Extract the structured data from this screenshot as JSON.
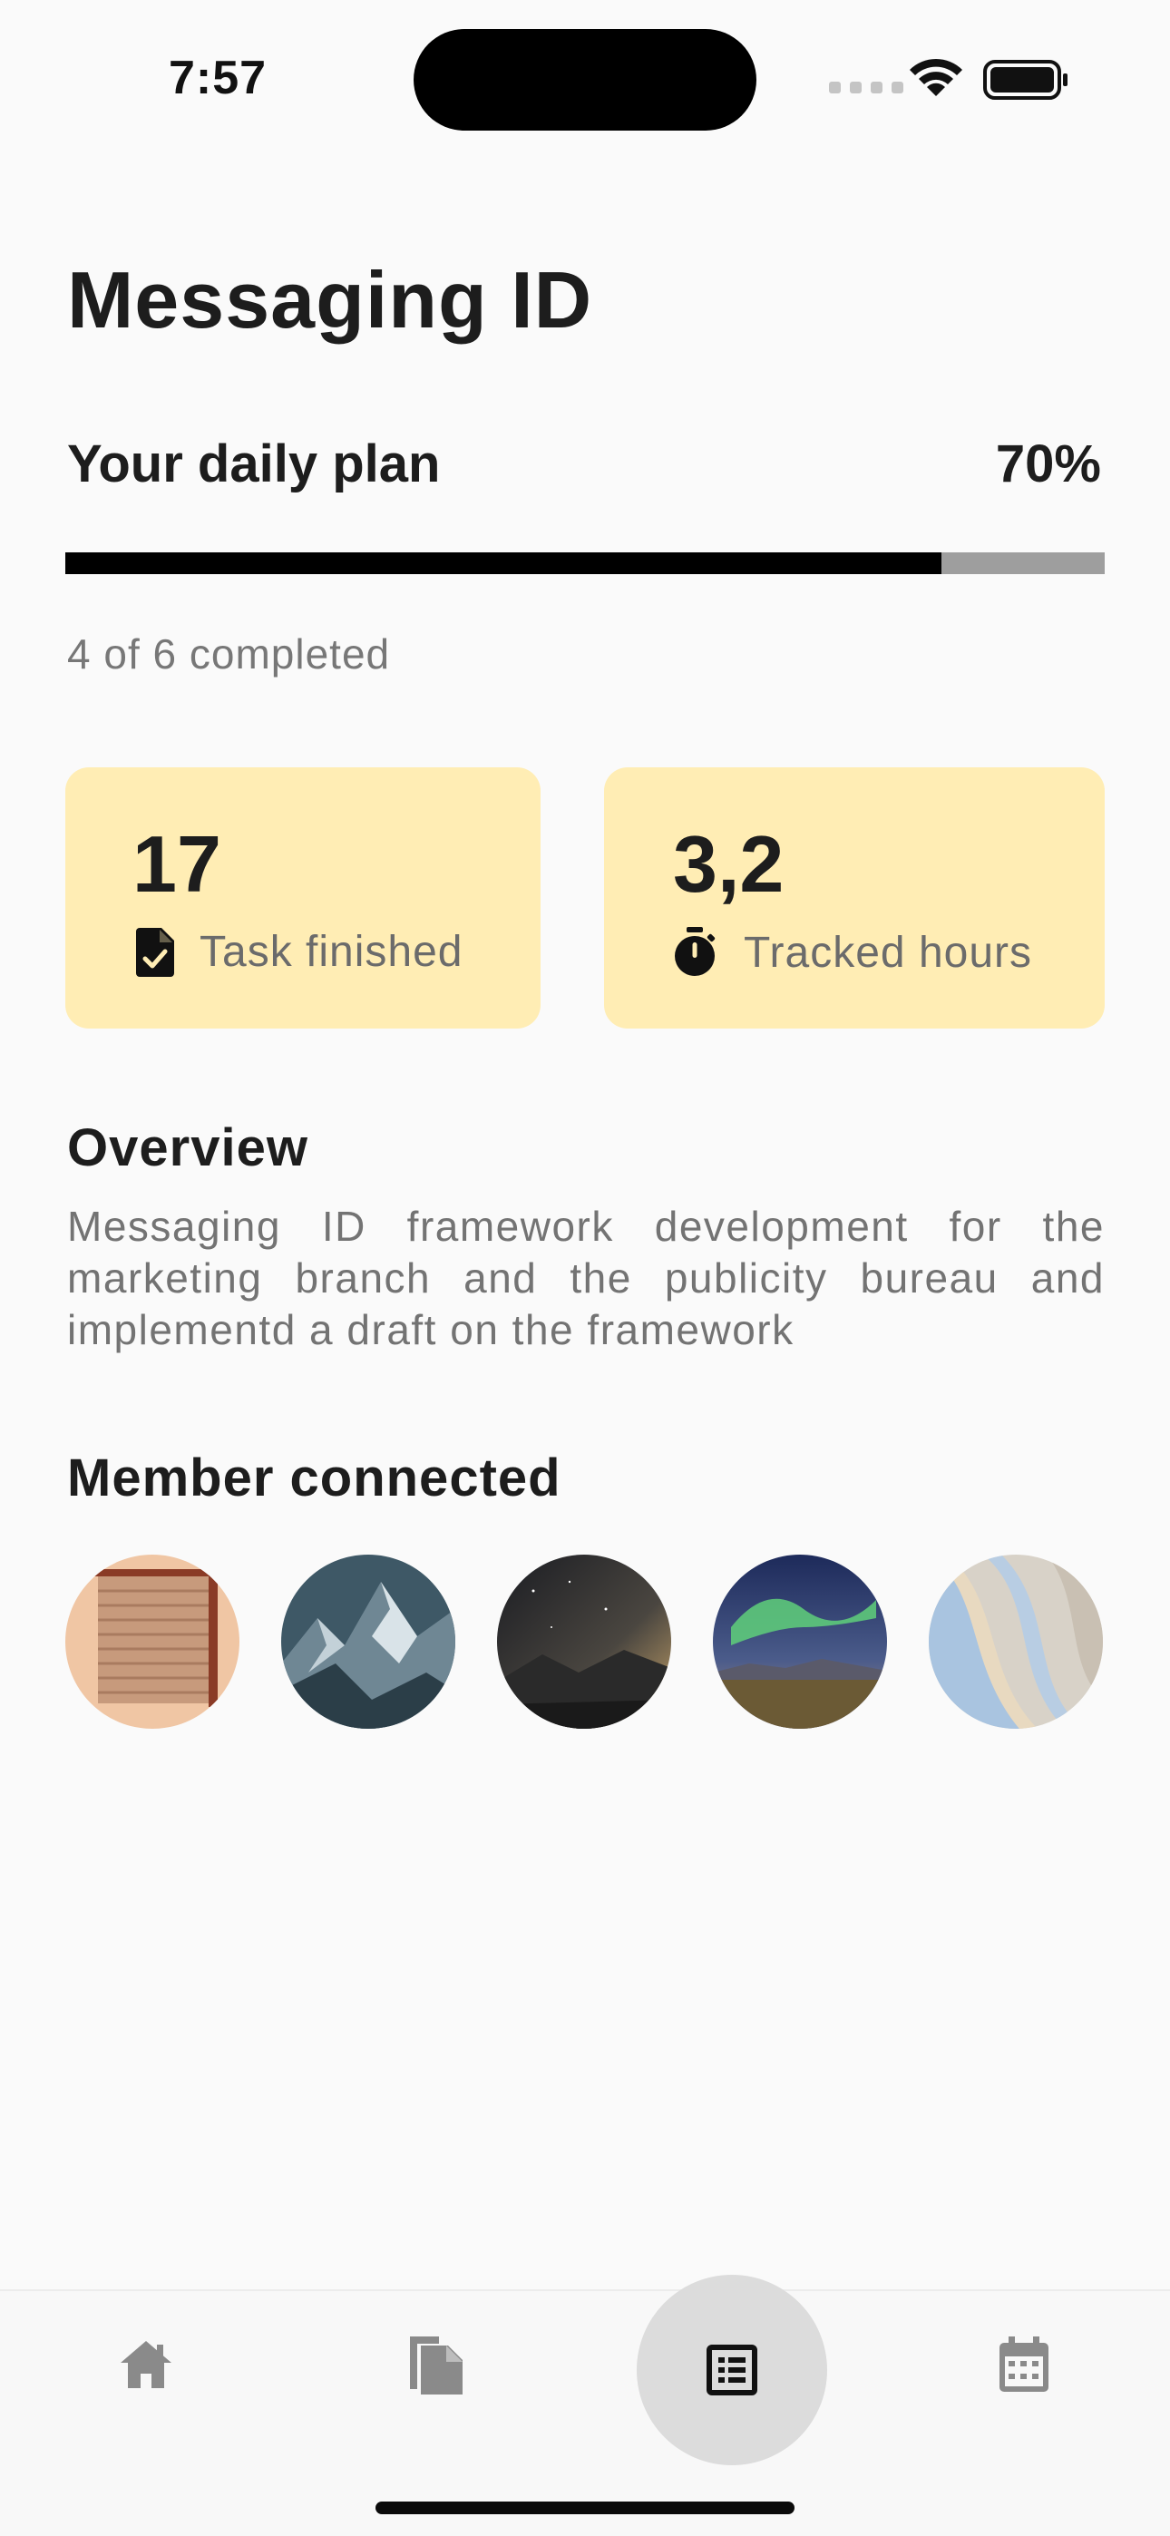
{
  "status_bar": {
    "time": "7:57"
  },
  "header": {
    "title": "Messaging ID"
  },
  "plan": {
    "label": "Your daily plan",
    "percent_label": "70%",
    "progress_fraction": 0.843,
    "completed_text": "4 of 6 completed"
  },
  "stats": [
    {
      "value": "17",
      "label": "Task finished",
      "icon": "task-done-icon"
    },
    {
      "value": "3,2",
      "label": "Tracked hours",
      "icon": "stopwatch-icon"
    }
  ],
  "overview": {
    "heading": "Overview",
    "text": "Messaging ID framework development for the marketing  branch and the publicity bureau and implementd a draft on the framework"
  },
  "members": {
    "heading": "Member connected",
    "avatars": [
      "shutter-door-photo",
      "snowy-mountain-photo",
      "milky-way-photo",
      "aurora-photo",
      "pastel-waves-photo"
    ]
  },
  "bottom_nav": {
    "items": [
      "home-icon",
      "documents-icon",
      "list-icon",
      "calendar-icon"
    ],
    "active_index": 2
  },
  "colors": {
    "background": "#fafafa",
    "card": "#ffedb4",
    "progress_fill": "#000000",
    "progress_track": "#9e9e9e",
    "nav_active": "#dcdcdc",
    "nav_icon": "#8a8a8a"
  }
}
